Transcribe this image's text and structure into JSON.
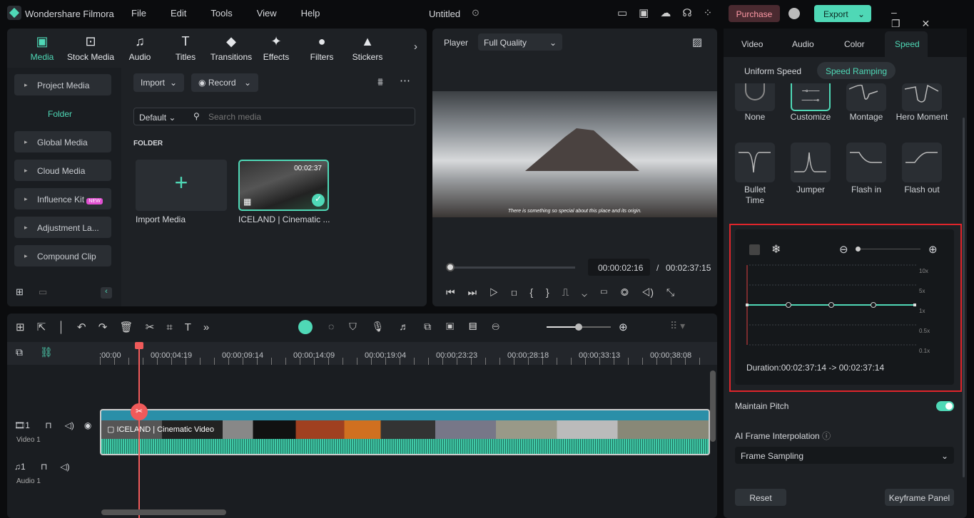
{
  "app": {
    "title": "Wondershare Filmora",
    "menu": [
      "File",
      "Edit",
      "Tools",
      "View",
      "Help"
    ],
    "project": "Untitled",
    "purchase": "Purchase",
    "export": "Export"
  },
  "tabs": [
    "Media",
    "Stock Media",
    "Audio",
    "Titles",
    "Transitions",
    "Effects",
    "Filters",
    "Stickers"
  ],
  "sidebar": {
    "project_media": "Project Media",
    "folder": "Folder",
    "items": [
      "Global Media",
      "Cloud Media",
      "Influence Kit",
      "Adjustment La...",
      "Compound Clip"
    ],
    "new_badge": "NEW"
  },
  "media": {
    "import": "Import",
    "record": "Record",
    "sort": "Default",
    "search_placeholder": "Search media",
    "folder_label": "FOLDER",
    "import_media": "Import Media",
    "clip_name": "ICELAND | Cinematic ...",
    "clip_duration": "00:02:37"
  },
  "player": {
    "label": "Player",
    "quality": "Full Quality",
    "subtitle": "There is something so special about this place and its origin.",
    "current": "00:00:02:16",
    "total": "00:02:37:15",
    "progress": 0.014
  },
  "timeline": {
    "ticks": [
      ":00:00",
      "00:00:04:19",
      "00:00:09:14",
      "00:00:14:09",
      "00:00:19:04",
      "00:00:23:23",
      "00:00:28:18",
      "00:00:33:13",
      "00:00:38:08"
    ],
    "video_track": "Video 1",
    "audio_track": "Audio 1",
    "clip_title": "ICELAND | Cinematic Video",
    "track_num": "1"
  },
  "right": {
    "tabs": [
      "Video",
      "Audio",
      "Color",
      "Speed"
    ],
    "active_tab": "Speed",
    "subtabs": [
      "Uniform Speed",
      "Speed Ramping"
    ],
    "presets": [
      "None",
      "Customize",
      "Montage",
      "Hero Moment",
      "Bullet Time",
      "Jumper",
      "Flash in",
      "Flash out"
    ],
    "graph_labels": [
      "10x",
      "5x",
      "1x",
      "0.5x",
      "0.1x"
    ],
    "duration": "Duration:00:02:37:14 -> 00:02:37:14",
    "maintain_pitch": "Maintain Pitch",
    "maintain_pitch_on": true,
    "ai_frame": "AI Frame Interpolation",
    "frame_mode": "Frame Sampling",
    "reset": "Reset",
    "keyframe": "Keyframe Panel",
    "accent": "#4fd8b6",
    "highlight": "#e0252b"
  }
}
